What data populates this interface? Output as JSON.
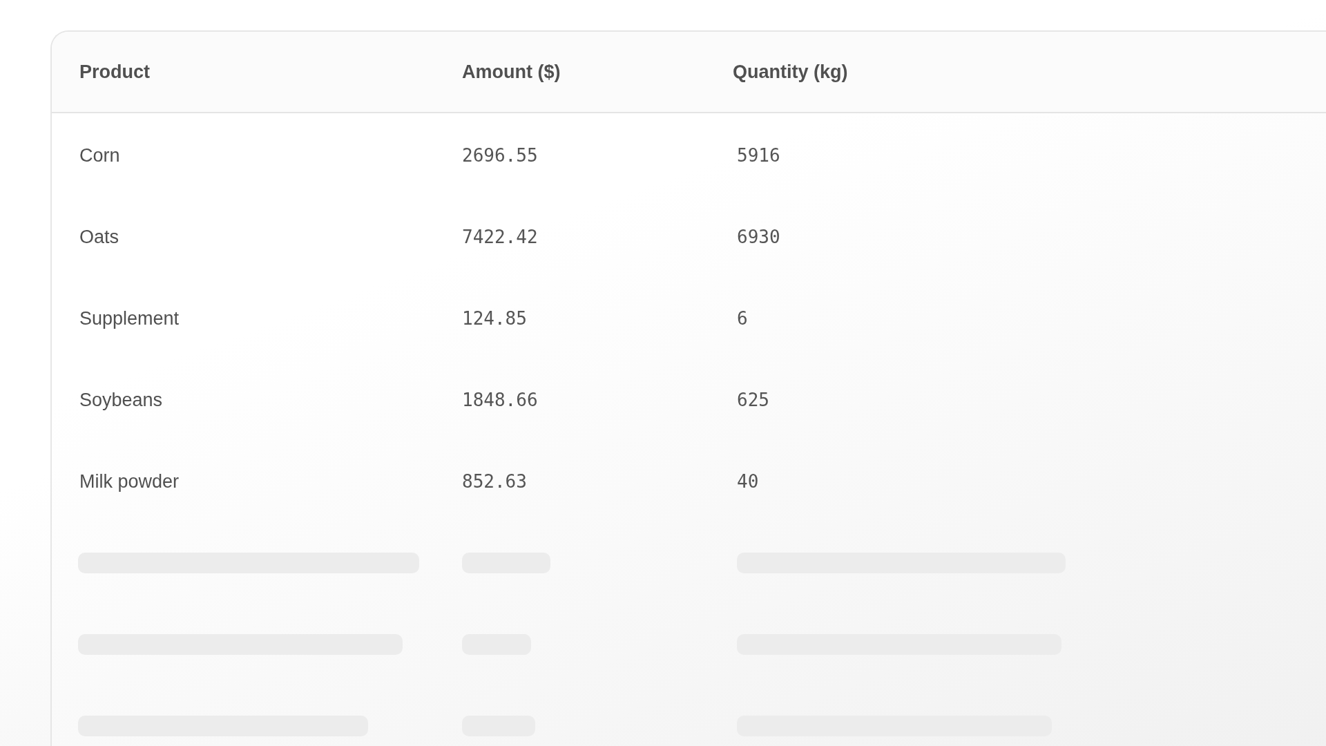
{
  "table": {
    "columns": [
      "Product",
      "Amount ($)",
      "Quantity (kg)"
    ],
    "rows": [
      {
        "kind": "data",
        "cells": [
          "Corn",
          "2696.55",
          "5916"
        ]
      },
      {
        "kind": "data",
        "cells": [
          "Oats",
          "7422.42",
          "6930"
        ]
      },
      {
        "kind": "data",
        "cells": [
          "Supplement",
          "124.85",
          "6"
        ]
      },
      {
        "kind": "data",
        "cells": [
          "Soybeans",
          "1848.66",
          "625"
        ]
      },
      {
        "kind": "data",
        "cells": [
          "Milk powder",
          "852.63",
          "40"
        ]
      },
      {
        "kind": "skeleton"
      },
      {
        "kind": "skeleton"
      },
      {
        "kind": "skeleton"
      }
    ]
  }
}
